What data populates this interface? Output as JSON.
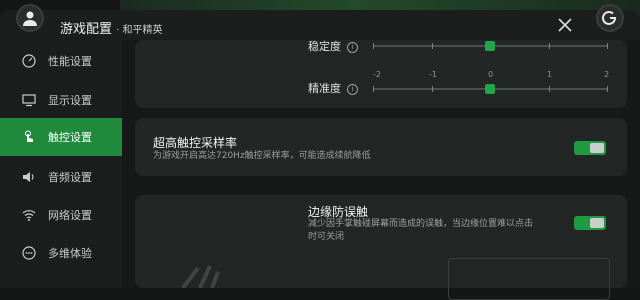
{
  "header": {
    "title": "游戏配置",
    "subtitle": "· 和平精英"
  },
  "sidebar": {
    "items": [
      {
        "label": "性能设置",
        "icon": "speedometer-icon"
      },
      {
        "label": "显示设置",
        "icon": "monitor-icon"
      },
      {
        "label": "触控设置",
        "icon": "touch-hand-icon",
        "active": true
      },
      {
        "label": "音频设置",
        "icon": "speaker-icon"
      },
      {
        "label": "网络设置",
        "icon": "wifi-icon"
      },
      {
        "label": "多维体验",
        "icon": "ellipsis-icon"
      }
    ]
  },
  "sliders": {
    "stability": {
      "label": "稳定度",
      "value": 0
    },
    "accuracy": {
      "label": "精准度",
      "value": 0,
      "scale": [
        "-2",
        "-1",
        "0",
        "1",
        "2"
      ]
    }
  },
  "high_touch": {
    "title": "超高触控采样率",
    "desc": "为游戏开启高达720Hz触控采样率，可能造成续航降低",
    "enabled": true
  },
  "edge_guard": {
    "title": "边缘防误触",
    "desc1": "减少因手掌触碰屏幕而造成的误触，当边缘位置难以点击",
    "desc2": "时可关闭",
    "enabled": true
  },
  "colors": {
    "accent": "#1f8a3c",
    "toggle": "#1f9a43"
  }
}
